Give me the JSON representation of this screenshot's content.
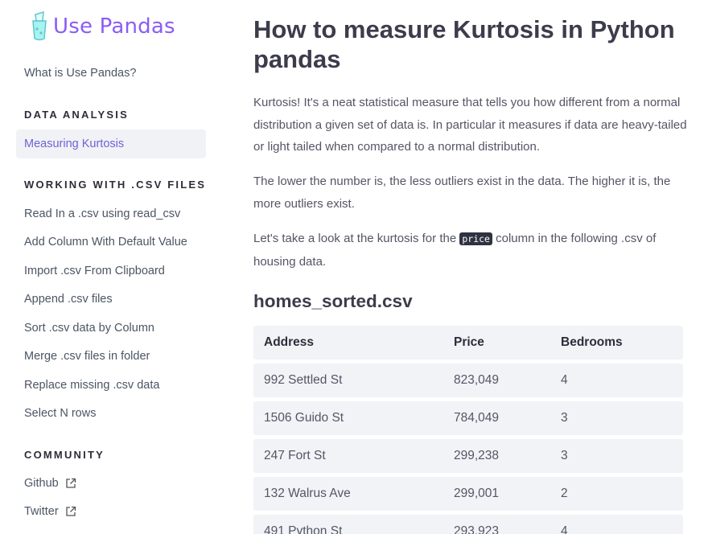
{
  "brand": {
    "name": "Use Pandas"
  },
  "sidebar": {
    "top_link": "What is Use Pandas?",
    "sections": [
      {
        "heading": "DATA ANALYSIS",
        "items": [
          "Measuring Kurtosis"
        ]
      },
      {
        "heading": "WORKING WITH .CSV FILES",
        "items": [
          "Read In a .csv using read_csv",
          "Add Column With Default Value",
          "Import .csv From Clipboard",
          "Append .csv files",
          "Sort .csv data by Column",
          "Merge .csv files in folder",
          "Replace missing .csv data",
          "Select N rows"
        ]
      },
      {
        "heading": "COMMUNITY",
        "items": [
          "Github",
          "Twitter"
        ]
      }
    ],
    "active_item": "Measuring Kurtosis"
  },
  "article": {
    "title": "How to measure Kurtosis in Python pandas",
    "paragraphs": [
      "Kurtosis! It's a neat statistical measure that tells you how different from a normal distribution a given set of data is. In particular it measures if data are heavy-tailed or light tailed when compared to a normal distribution.",
      "The lower the number is, the less outliers exist in the data. The higher it is, the more outliers exist."
    ],
    "p3_before": "Let's take a look at the kurtosis for the ",
    "p3_code": "price",
    "p3_after": " column in the following .csv of housing data.",
    "table_title": "homes_sorted.csv",
    "table": {
      "headers": [
        "Address",
        "Price",
        "Bedrooms"
      ],
      "rows": [
        [
          "992 Settled St",
          "823,049",
          "4"
        ],
        [
          "1506 Guido St",
          "784,049",
          "3"
        ],
        [
          "247 Fort St",
          "299,238",
          "3"
        ],
        [
          "132 Walrus Ave",
          "299,001",
          "2"
        ],
        [
          "491 Python St",
          "293,923",
          "4"
        ]
      ]
    }
  },
  "colors": {
    "brand": "#8b5cf6",
    "active": "#6d62d6",
    "code_bg": "#2f3340"
  },
  "icons": {
    "logo": "pandas-glass-icon",
    "external": "external-link-icon"
  }
}
